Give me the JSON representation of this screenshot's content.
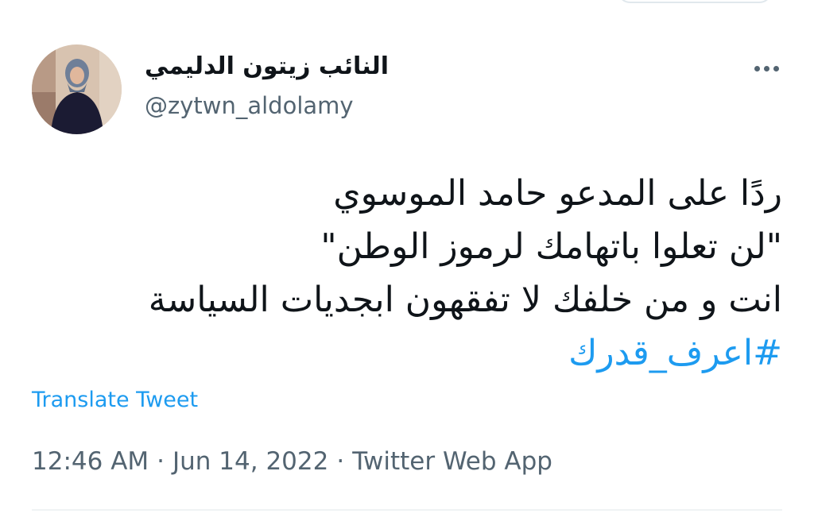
{
  "author": {
    "display_name": "النائب زيتون الدليمي",
    "handle": "@zytwn_aldolamy"
  },
  "tweet": {
    "lines": [
      "ردًا على المدعو حامد الموسوي",
      "\"لن تعلوا باتهامك لرموز الوطن\"",
      "انت و من خلفك لا تفقهون ابجديات السياسة"
    ],
    "hashtag": "#اعرف_قدرك",
    "translate_label": "Translate Tweet"
  },
  "meta": {
    "time": "12:46 AM",
    "separator": "·",
    "date": "Jun 14, 2022",
    "source": "Twitter Web App"
  },
  "icons": {
    "more": "more-horizontal-icon"
  },
  "colors": {
    "text": "#0f1419",
    "secondary": "#536471",
    "accent": "#1d9bf0",
    "divider": "#eff3f4"
  }
}
